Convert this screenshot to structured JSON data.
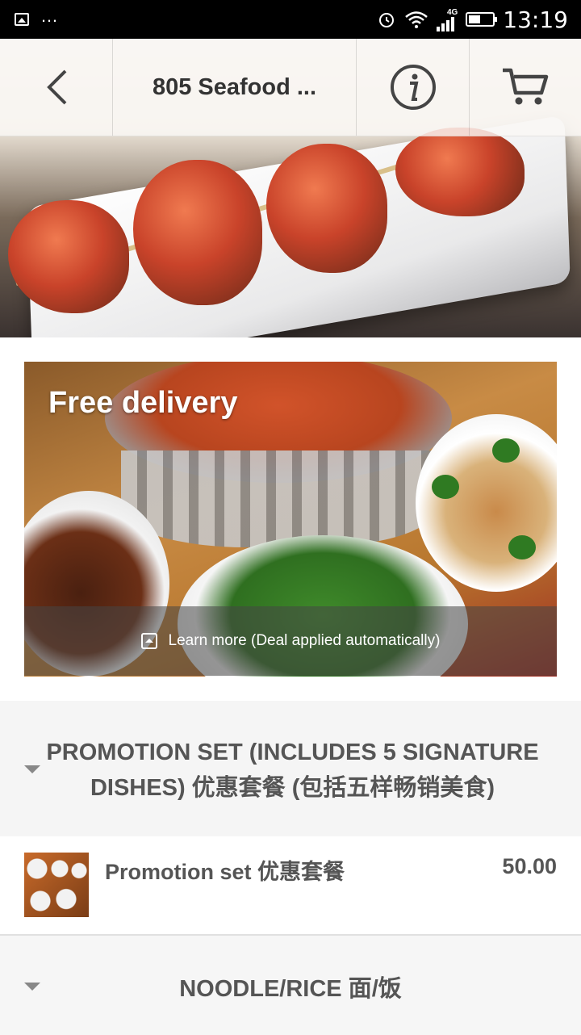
{
  "status_bar": {
    "time": "13:19",
    "network": "4G",
    "icons": [
      "gallery-icon",
      "more-dots-icon",
      "alarm-icon",
      "wifi-icon",
      "signal-icon",
      "battery-icon"
    ]
  },
  "header": {
    "title": "805 Seafood ...",
    "icons": {
      "back": "back-arrow-icon",
      "info": "info-icon",
      "cart": "cart-icon"
    }
  },
  "promo": {
    "title": "Free delivery",
    "learn_more": "Learn more (Deal applied automatically)"
  },
  "sections": [
    {
      "title": "PROMOTION SET (INCLUDES 5 SIGNATURE DISHES) 优惠套餐 (包括五样畅销美食)",
      "items": [
        {
          "name": "Promotion set 优惠套餐",
          "price": "50.00"
        }
      ]
    },
    {
      "title": "NOODLE/RICE 面/饭"
    }
  ],
  "colors": {
    "status_bar": "#000000",
    "section_bg": "#f5f5f5",
    "text_dark": "#555555",
    "promo_text": "#ffffff"
  }
}
